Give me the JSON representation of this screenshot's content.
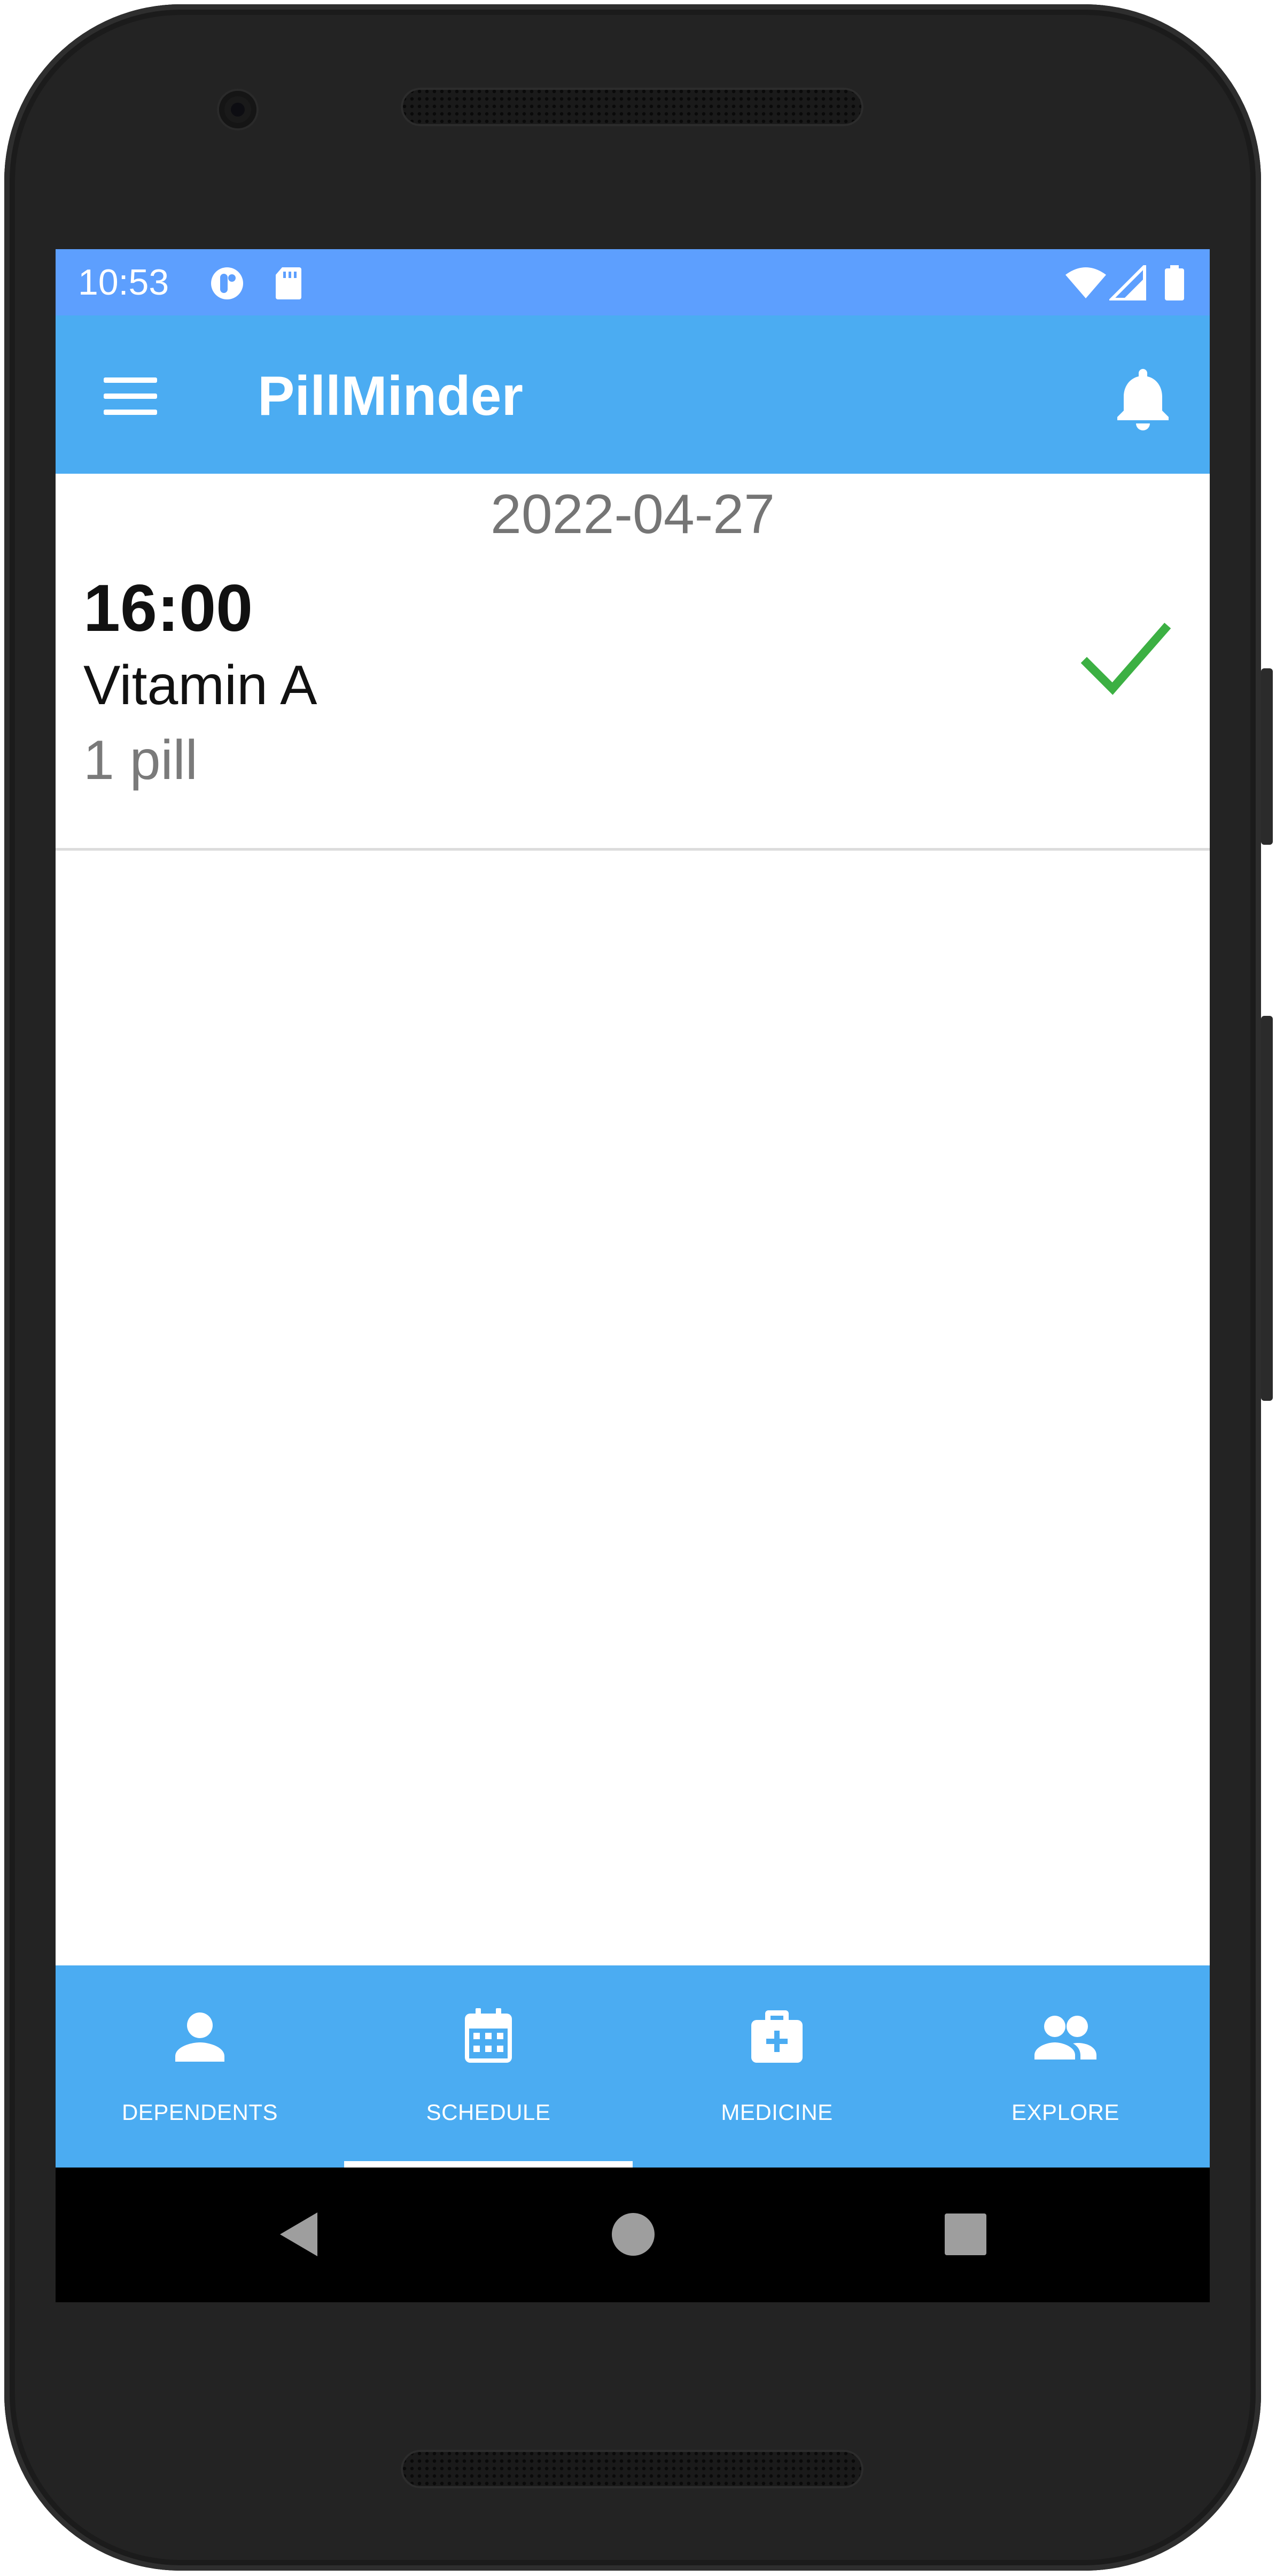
{
  "status_bar": {
    "time": "10:53"
  },
  "app_bar": {
    "title": "PillMinder"
  },
  "schedule": {
    "date": "2022-04-27",
    "doses": [
      {
        "time": "16:00",
        "name": "Vitamin A",
        "amount": "1 pill",
        "status": "taken"
      }
    ]
  },
  "bottom_nav": {
    "items": [
      {
        "label": "DEPENDENTS",
        "icon": "person-icon"
      },
      {
        "label": "SCHEDULE",
        "icon": "calendar-icon",
        "selected": true
      },
      {
        "label": "MEDICINE",
        "icon": "medical-kit-icon"
      },
      {
        "label": "EXPLORE",
        "icon": "people-icon"
      }
    ]
  },
  "colors": {
    "status_bar": "#5d9ffe",
    "primary": "#4bacf2",
    "check": "#3cb043",
    "date_text": "#757575"
  }
}
